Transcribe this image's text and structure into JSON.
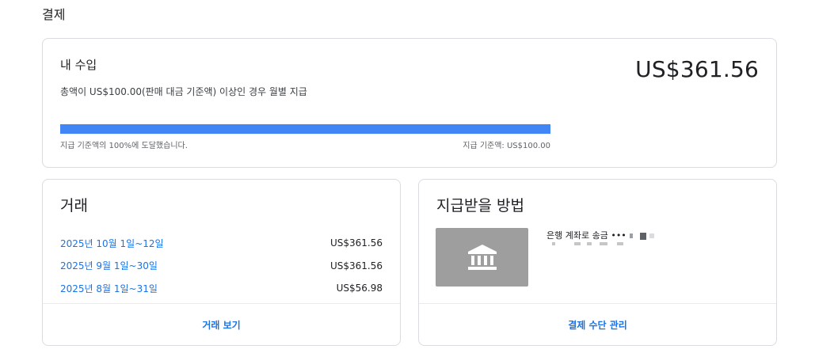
{
  "page": {
    "title": "결제"
  },
  "earnings": {
    "title": "내 수입",
    "subtitle": "총액이 US$100.00(판매 대금 기준액) 이상인 경우 월별 지급",
    "amount": "US$361.56",
    "progress_percent": 100,
    "progress_left_label": "지급 기준액의 100%에 도달했습니다.",
    "progress_right_label": "지급 기준액: US$100.00",
    "accent_color": "#4285f4"
  },
  "transactions": {
    "title": "거래",
    "rows": [
      {
        "period": "2025년 10월 1일~12일",
        "amount": "US$361.56"
      },
      {
        "period": "2025년 9월 1일~30일",
        "amount": "US$361.56"
      },
      {
        "period": "2025년 8월 1일~31일",
        "amount": "US$56.98"
      }
    ],
    "footer_label": "거래 보기"
  },
  "payment_method": {
    "title": "지급받을 방법",
    "icon": "bank-icon",
    "method_label": "은행 계좌로 송금 •••",
    "footer_label": "결제 수단 관리"
  },
  "colors": {
    "link": "#1a73e8",
    "border": "#dadce0",
    "bank_tile": "#9e9e9e"
  }
}
